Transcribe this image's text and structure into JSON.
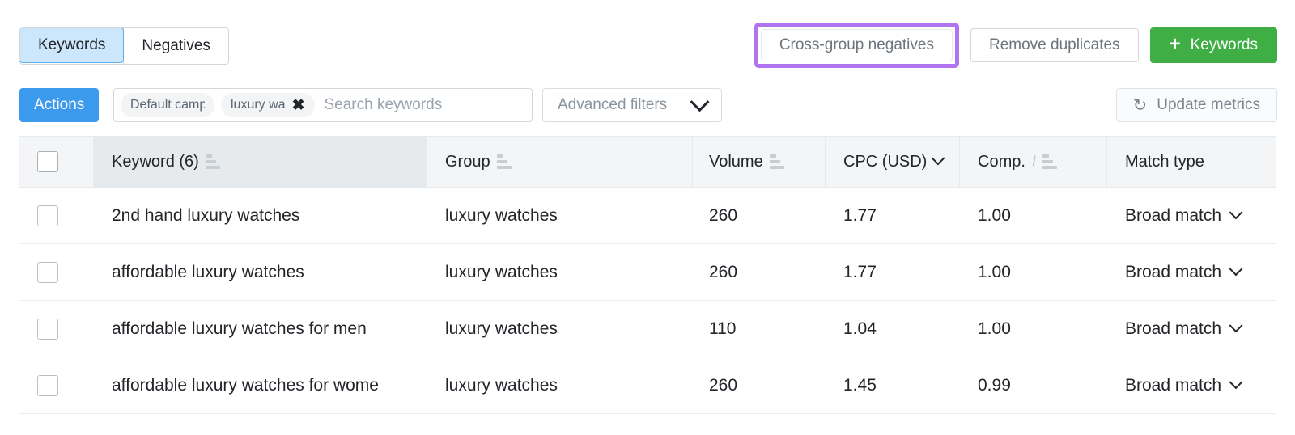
{
  "tabs": {
    "items": [
      {
        "label": "Keywords",
        "active": true
      },
      {
        "label": "Negatives",
        "active": false
      }
    ]
  },
  "toolbar": {
    "cross_group_negatives_label": "Cross-group negatives",
    "remove_duplicates_label": "Remove duplicates",
    "add_keywords_label": "Keywords",
    "add_icon": "plus-icon",
    "highlight_color": "#b074f0",
    "add_button_color": "#3fae45"
  },
  "filterbar": {
    "actions_label": "Actions",
    "actions_color": "#3b9aeb",
    "chips": [
      {
        "label": "Default campa",
        "removable": false
      },
      {
        "label": "luxury wa",
        "removable": true,
        "remove_icon": "close-icon"
      }
    ],
    "search": {
      "placeholder": "Search keywords",
      "value": ""
    },
    "advanced_filters_label": "Advanced filters",
    "advanced_filters_icon": "chevron-down-icon",
    "update_metrics_label": "Update metrics",
    "update_metrics_icon": "refresh-icon"
  },
  "table": {
    "columns": [
      {
        "key": "check",
        "label": "",
        "icon": "checkbox",
        "sorted": false
      },
      {
        "key": "keyword",
        "label": "Keyword (6)",
        "icon": "sort-icon",
        "sorted": true
      },
      {
        "key": "group",
        "label": "Group",
        "icon": "sort-icon",
        "sorted": false
      },
      {
        "key": "volume",
        "label": "Volume",
        "icon": "sort-icon",
        "sorted": false
      },
      {
        "key": "cpc",
        "label": "CPC (USD)",
        "icon": "chevron-down-icon",
        "sorted": false
      },
      {
        "key": "comp",
        "label": "Comp.",
        "icon": "info-icon",
        "sorted": false
      },
      {
        "key": "match",
        "label": "Match type",
        "icon": "",
        "sorted": false
      }
    ],
    "rows": [
      {
        "keyword": "2nd hand luxury watches",
        "group": "luxury watches",
        "volume": "260",
        "cpc": "1.77",
        "comp": "1.00",
        "match_type": "Broad match"
      },
      {
        "keyword": "affordable luxury watches",
        "group": "luxury watches",
        "volume": "260",
        "cpc": "1.77",
        "comp": "1.00",
        "match_type": "Broad match"
      },
      {
        "keyword": "affordable luxury watches for men",
        "group": "luxury watches",
        "volume": "110",
        "cpc": "1.04",
        "comp": "1.00",
        "match_type": "Broad match"
      },
      {
        "keyword": "affordable luxury watches for wome",
        "group": "luxury watches",
        "volume": "260",
        "cpc": "1.45",
        "comp": "0.99",
        "match_type": "Broad match"
      }
    ]
  }
}
